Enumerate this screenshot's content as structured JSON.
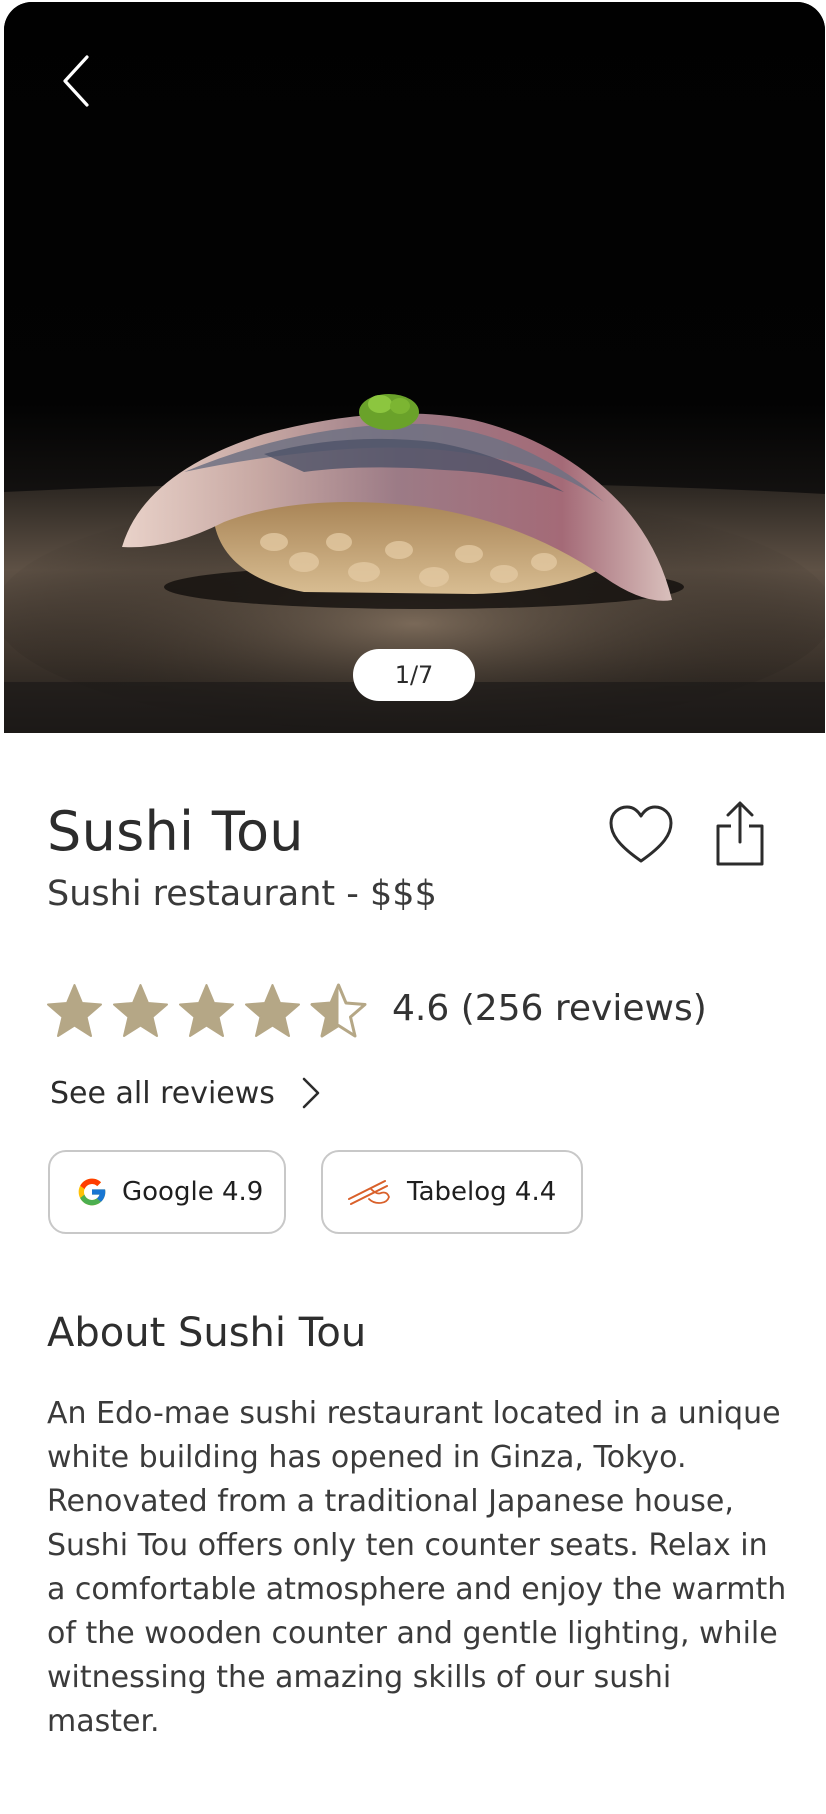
{
  "hero": {
    "image_alt": "Sushi nigiri photo",
    "counter": "1/7",
    "back_icon": "chevron-left-icon"
  },
  "restaurant": {
    "name": "Sushi Tou",
    "subtitle": "Sushi restaurant - $$$"
  },
  "actions": {
    "favorite_icon": "heart-outline-icon",
    "share_icon": "share-icon"
  },
  "rating": {
    "value": 4.6,
    "stars_filled": 4,
    "stars_total": 5,
    "text": "4.6 (256 reviews)",
    "star_color": "#b5a786"
  },
  "reviews_link": {
    "label": "See all reviews"
  },
  "sources": [
    {
      "label": "Google 4.9",
      "icon": "google-logo-icon"
    },
    {
      "label": "Tabelog 4.4",
      "icon": "chopsticks-icon"
    }
  ],
  "about": {
    "heading": "About Sushi Tou",
    "body": "An Edo-mae sushi restaurant located in a unique white building has opened in Ginza, Tokyo. Renovated from a traditional Japanese house, Sushi Tou offers only ten counter seats. Relax in a comfortable atmosphere and enjoy the warmth of the wooden counter and gentle lighting, while witnessing the amazing skills of our sushi master."
  },
  "colors": {
    "text": "#2c2c2c",
    "star": "#b5a786",
    "pill_border": "#c8c8c8",
    "tabelog_orange": "#d9602a"
  }
}
